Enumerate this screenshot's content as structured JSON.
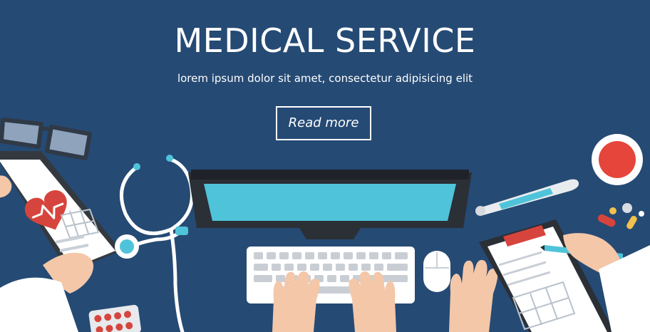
{
  "hero": {
    "title": "MEDICAL SERVICE",
    "subtitle": "lorem ipsum dolor sit amet, consectetur adipisicing elit",
    "button_label": "Read more"
  },
  "colors": {
    "background": "#254a74",
    "heart_red": "#d6453d",
    "screen_cyan": "#4fc3d9",
    "monitor_dark": "#2b2f36",
    "skin": "#f3c7a8",
    "white": "#ffffff"
  },
  "illustration": {
    "icons": [
      "glasses-icon",
      "tablet-heart-icon",
      "stethoscope-icon",
      "monitor-icon",
      "keyboard-icon",
      "mouse-icon",
      "thermometer-icon",
      "cup-icon",
      "pills-icon",
      "clipboard-icon",
      "pen-icon",
      "blister-pack-icon",
      "hands-icon"
    ]
  }
}
